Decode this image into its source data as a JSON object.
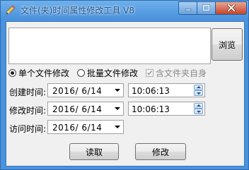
{
  "window": {
    "title": "文件(夹)时间属性修改工具 V8",
    "icon": "pencil-icon",
    "controls": {
      "minimize": "minimize-icon",
      "maximize": "maximize-icon",
      "close": "close-icon"
    }
  },
  "path_input": {
    "value": "",
    "placeholder": ""
  },
  "browse_button": "浏览",
  "mode": {
    "single_label": "单个文件修改",
    "batch_label": "批量文件修改",
    "selected": "single",
    "include_folder_label": "含文件夹自身",
    "include_folder_checked": true,
    "include_folder_enabled": false
  },
  "fields": {
    "created": {
      "label": "创建时间:",
      "date": "2016/ 6/14",
      "time": "10:06:13"
    },
    "modified": {
      "label": "修改时间:",
      "date": "2016/ 6/14",
      "time": "10:06:13"
    },
    "accessed": {
      "label": "访问时间:",
      "date": "2016/ 6/14"
    }
  },
  "actions": {
    "read_label": "读取",
    "modify_label": "修改"
  },
  "colors": {
    "title_bar": "#4a92dc",
    "client_bg": "#f0f0f0",
    "close_button": "#c5432b"
  }
}
